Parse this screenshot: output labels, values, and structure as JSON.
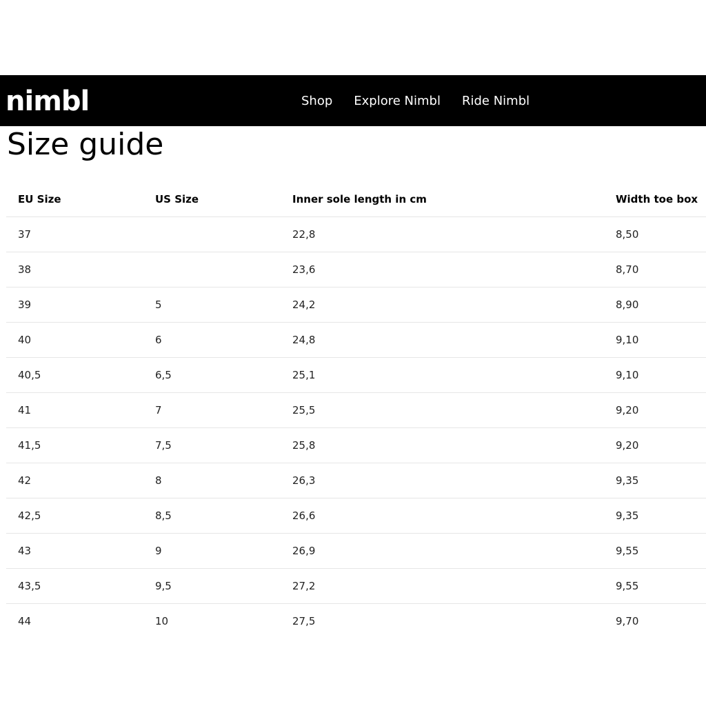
{
  "brand": {
    "logo_text": "nimbl"
  },
  "nav": {
    "items": [
      {
        "label": "Shop"
      },
      {
        "label": "Explore Nimbl"
      },
      {
        "label": "Ride Nimbl"
      }
    ]
  },
  "page": {
    "title": "Size guide"
  },
  "table": {
    "headers": [
      "EU Size",
      "US Size",
      "Inner sole length in cm",
      "Width toe box"
    ],
    "rows": [
      [
        "37",
        "",
        "22,8",
        "8,50"
      ],
      [
        "38",
        "",
        "23,6",
        "8,70"
      ],
      [
        "39",
        "5",
        "24,2",
        "8,90"
      ],
      [
        "40",
        "6",
        "24,8",
        "9,10"
      ],
      [
        "40,5",
        "6,5",
        "25,1",
        "9,10"
      ],
      [
        "41",
        "7",
        "25,5",
        "9,20"
      ],
      [
        "41,5",
        "7,5",
        "25,8",
        "9,20"
      ],
      [
        "42",
        "8",
        "26,3",
        "9,35"
      ],
      [
        "42,5",
        "8,5",
        "26,6",
        "9,35"
      ],
      [
        "43",
        "9",
        "26,9",
        "9,55"
      ],
      [
        "43,5",
        "9,5",
        "27,2",
        "9,55"
      ],
      [
        "44",
        "10",
        "27,5",
        "9,70"
      ]
    ]
  },
  "colors": {
    "navbar_bg": "#000000",
    "navbar_text": "#ffffff",
    "row_divider": "#e6e6e6"
  }
}
